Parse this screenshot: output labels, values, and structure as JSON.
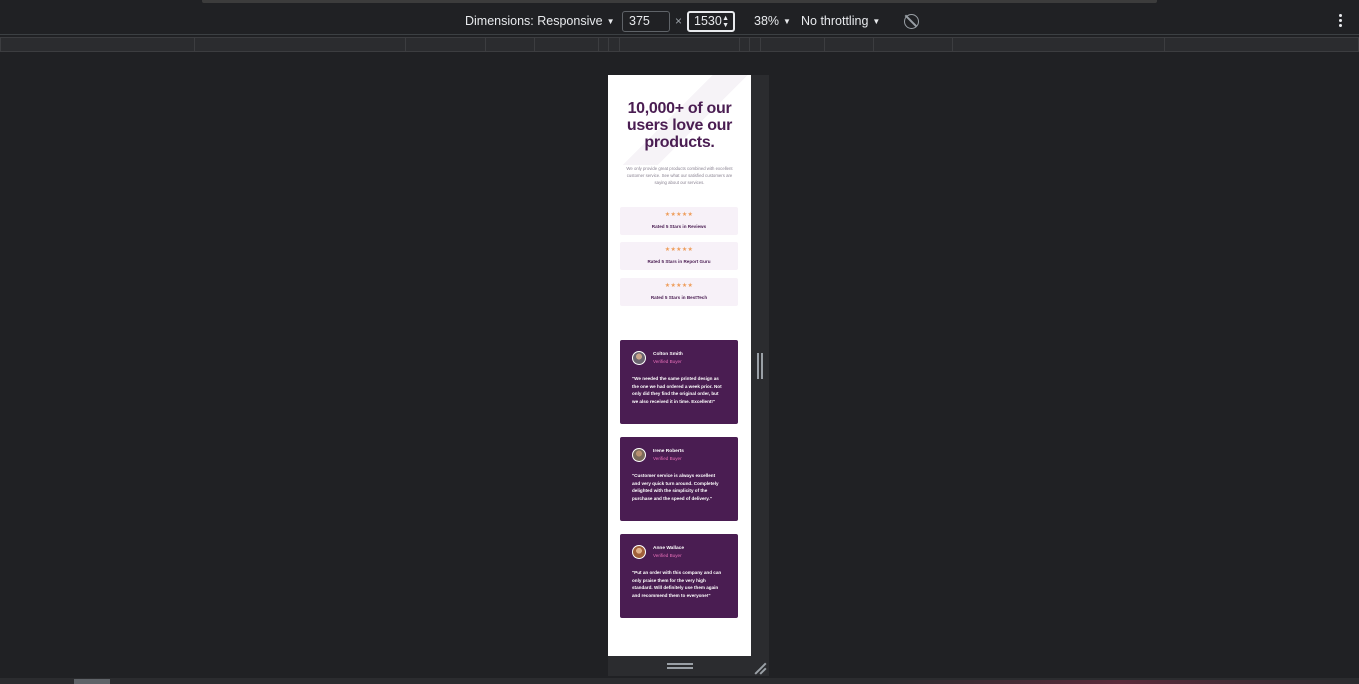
{
  "devtools": {
    "dimensions_label": "Dimensions: Responsive",
    "width_value": "375",
    "height_value": "1530",
    "times": "×",
    "zoom_label": "38%",
    "throttling_label": "No throttling"
  },
  "page": {
    "headline": "10,000+ of our users love our products.",
    "subtext": "We only provide great products combined with excellent customer service. See what our satisfied customers are saying about our services.",
    "ratings": [
      {
        "stars": "★★★★★",
        "label": "Rated 5 Stars in Reviews"
      },
      {
        "stars": "★★★★★",
        "label": "Rated 5 Stars in Report Guru"
      },
      {
        "stars": "★★★★★",
        "label": "Rated 5 Stars in BestTech"
      }
    ],
    "testimonials": [
      {
        "name": "Colton Smith",
        "verified": "Verified Buyer",
        "quote": "\"We needed the same printed design as the one we had ordered a week prior. Not only did they find the original order, but we also received it in time. Excellent!\""
      },
      {
        "name": "Irene Roberts",
        "verified": "Verified Buyer",
        "quote": "\"Customer service is always excellent and very quick turn around. Completely delighted with the simplicity of the purchase and the speed of delivery.\""
      },
      {
        "name": "Anne Wallace",
        "verified": "Verified Buyer",
        "quote": "\"Put an order with this company and can only praise them for the very high standard. Will definitely use them again and recommend them to everyone!\""
      }
    ]
  },
  "colors": {
    "devtools_bg": "#202124",
    "accent_purple": "#4a1d52",
    "star_orange": "#ee9d5b",
    "verified_pink": "#e86eb9",
    "rating_bg": "#f7f1f8"
  }
}
